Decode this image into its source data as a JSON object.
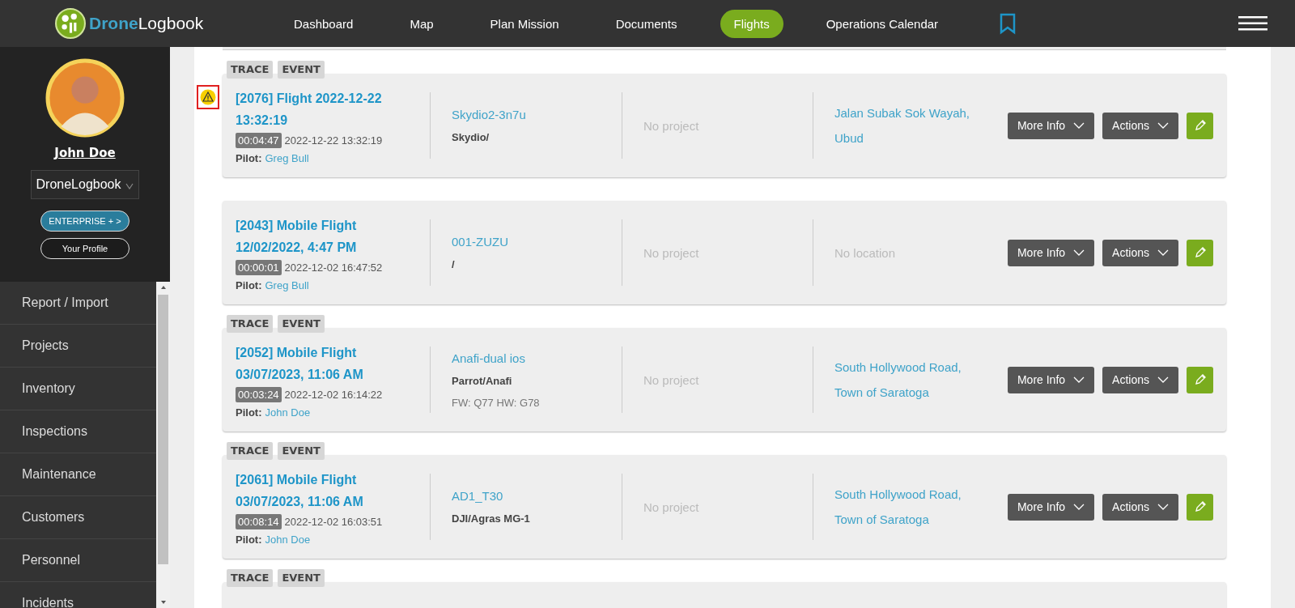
{
  "brand": {
    "first": "Drone",
    "second": "Logbook"
  },
  "nav": [
    {
      "label": "Dashboard",
      "selected": false
    },
    {
      "label": "Map",
      "selected": false
    },
    {
      "label": "Plan Mission",
      "selected": false
    },
    {
      "label": "Documents",
      "selected": false
    },
    {
      "label": "Flights",
      "selected": true
    },
    {
      "label": "Operations Calendar",
      "selected": false
    }
  ],
  "user": {
    "name": "John Doe",
    "organization": "DroneLogbook",
    "plan_button": "ENTERPRISE + >",
    "profile_button": "Your Profile"
  },
  "sidebar": {
    "items": [
      {
        "label": "Report / Import"
      },
      {
        "label": "Projects"
      },
      {
        "label": "Inventory"
      },
      {
        "label": "Inspections"
      },
      {
        "label": "Maintenance"
      },
      {
        "label": "Customers"
      },
      {
        "label": "Personnel"
      },
      {
        "label": "Incidents"
      }
    ]
  },
  "flights": [
    {
      "tags": [
        "TRACE",
        "EVENT"
      ],
      "warning": true,
      "title_lines": [
        "[2076] Flight 2022-12-22",
        "13:32:19"
      ],
      "duration": "00:04:47",
      "datetime": "2022-12-22 13:32:19",
      "pilot_label": "Pilot:",
      "pilot": "Greg Bull",
      "drone": "Skydio2-3n7u",
      "model": "Skydio/",
      "project": {
        "text": "No project",
        "muted": true
      },
      "location": {
        "lines": [
          "Jalan Subak Sok Wayah,",
          "Ubud"
        ],
        "muted": false
      },
      "buttons": [
        "More Info",
        "Actions"
      ]
    },
    {
      "warning": false,
      "title_lines": [
        "[2043] Mobile Flight",
        "12/02/2022, 4:47 PM"
      ],
      "duration": "00:00:01",
      "datetime": "2022-12-02 16:47:52",
      "pilot_label": "Pilot:",
      "pilot": "Greg Bull",
      "drone": "001-ZUZU",
      "model": "/",
      "project": {
        "text": "No project",
        "muted": true
      },
      "location": {
        "lines": [
          "No location"
        ],
        "muted": true
      },
      "buttons": [
        "More Info",
        "Actions"
      ]
    },
    {
      "tags": [
        "TRACE",
        "EVENT"
      ],
      "warning": false,
      "title_lines": [
        "[2052] Mobile Flight",
        "03/07/2023, 11:06 AM"
      ],
      "duration": "00:03:24",
      "datetime": "2022-12-02 16:14:22",
      "pilot_label": "Pilot:",
      "pilot": "John Doe",
      "drone": "Anafi-dual ios",
      "model": "Parrot/Anafi",
      "firmware": "FW: Q77 HW: G78",
      "project": {
        "text": "No project",
        "muted": true
      },
      "location": {
        "lines": [
          "South Hollywood Road,",
          "Town of Saratoga"
        ],
        "muted": false
      },
      "buttons": [
        "More Info",
        "Actions"
      ]
    },
    {
      "tags": [
        "TRACE",
        "EVENT"
      ],
      "warning": false,
      "title_lines": [
        "[2061] Mobile Flight",
        "03/07/2023, 11:06 AM"
      ],
      "duration": "00:08:14",
      "datetime": "2022-12-02 16:03:51",
      "pilot_label": "Pilot:",
      "pilot": "John Doe",
      "drone": "AD1_T30",
      "model": "DJI/Agras MG-1",
      "project": {
        "text": "No project",
        "muted": true
      },
      "location": {
        "lines": [
          "South Hollywood Road,",
          "Town of Saratoga"
        ],
        "muted": false
      },
      "buttons": [
        "More Info",
        "Actions"
      ]
    },
    {
      "tags": [
        "TRACE",
        "EVENT"
      ],
      "warning": false,
      "partial": true
    }
  ]
}
